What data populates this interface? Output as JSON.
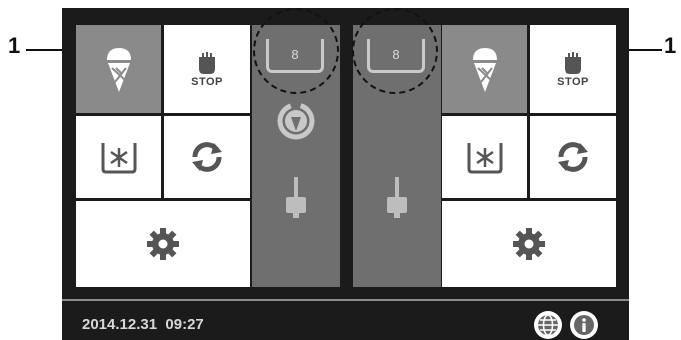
{
  "callouts": {
    "left_label": "1",
    "right_label": "1"
  },
  "left_group": {
    "stop_label": "STOP",
    "tiles": {
      "cone": {
        "icon": "ice-cream-cone-icon",
        "active": true
      },
      "stop": {
        "icon": "stop-hand-icon"
      },
      "freeze": {
        "icon": "freeze-tank-icon"
      },
      "refresh": {
        "icon": "refresh-icon"
      },
      "settings": {
        "icon": "gear-icon"
      }
    }
  },
  "right_group": {
    "stop_label": "STOP",
    "tiles": {
      "cone": {
        "icon": "ice-cream-cone-icon",
        "active": true
      },
      "stop": {
        "icon": "stop-hand-icon"
      },
      "freeze": {
        "icon": "freeze-tank-icon"
      },
      "refresh": {
        "icon": "refresh-icon"
      },
      "settings": {
        "icon": "gear-icon"
      }
    }
  },
  "left_panel": {
    "tank_value": "8",
    "icons": [
      "tank-level-icon",
      "cone-cycle-icon",
      "dispense-lever-icon"
    ]
  },
  "right_panel": {
    "tank_value": "8",
    "icons": [
      "tank-level-icon",
      "dispense-lever-icon"
    ]
  },
  "footer": {
    "datetime": "2014.12.31  09:27",
    "icons": [
      "globe-icon",
      "info-icon"
    ]
  },
  "colors": {
    "screen": "#1b1b1b",
    "panel": "#6f6f6f",
    "active_tile": "#8a8a8a",
    "tile": "#ffffff"
  }
}
